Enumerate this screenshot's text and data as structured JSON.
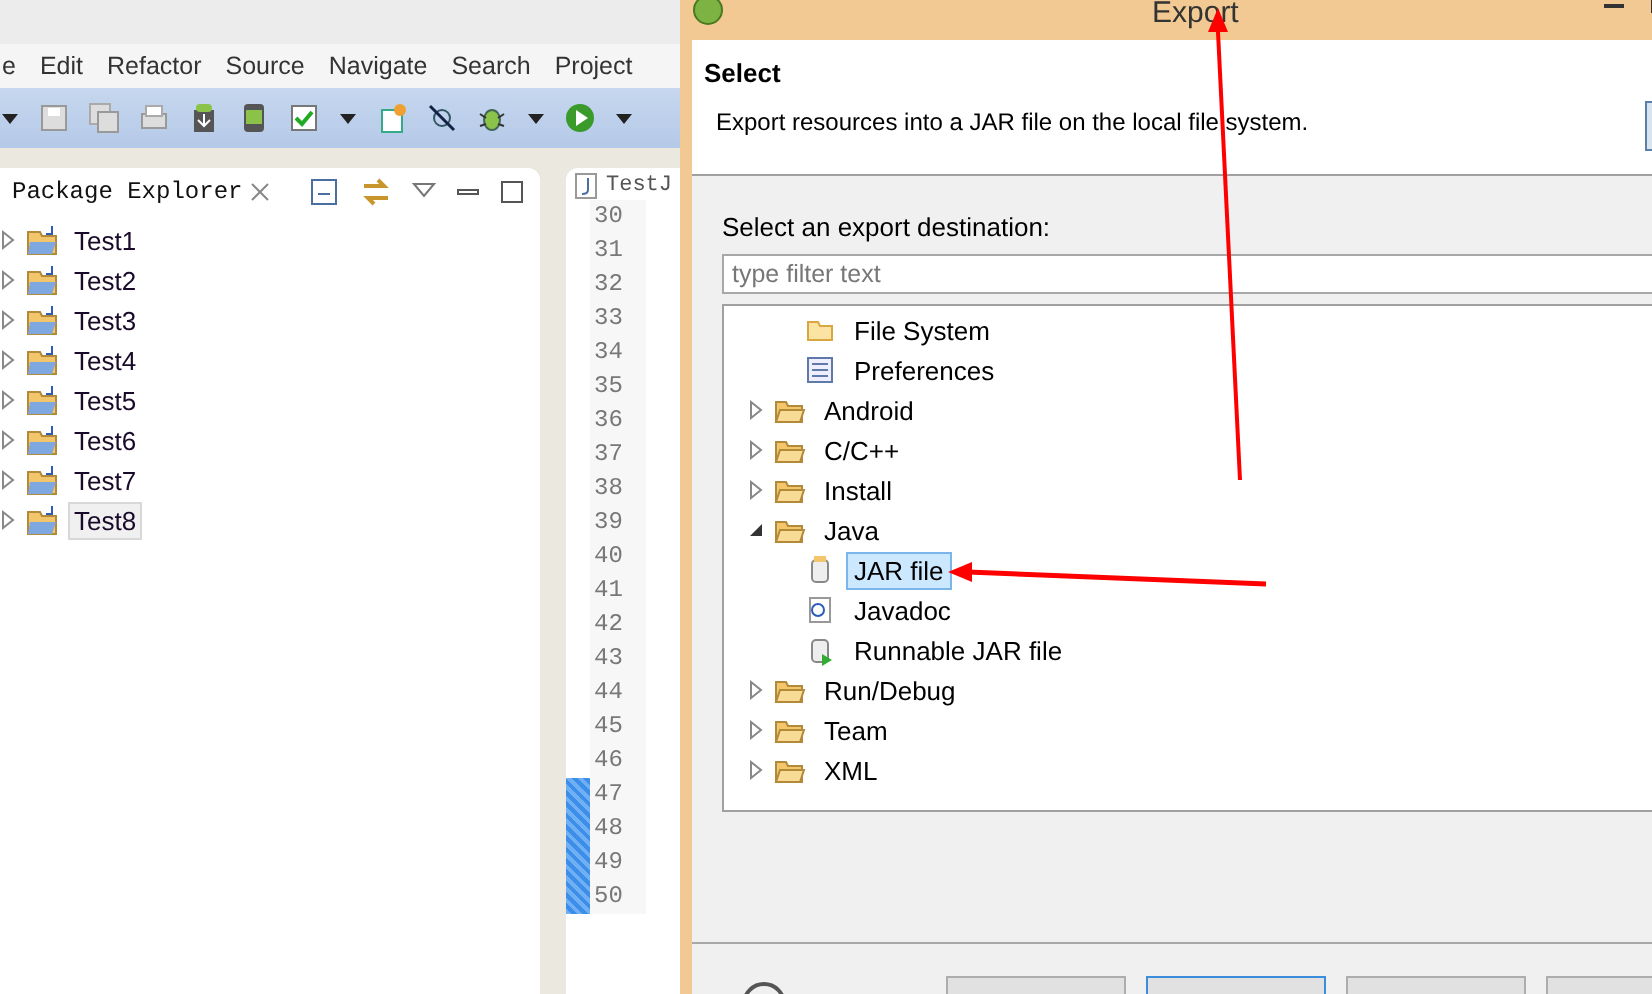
{
  "ide": {
    "menu": [
      "e",
      "Edit",
      "Refactor",
      "Source",
      "Navigate",
      "Search",
      "Project"
    ],
    "explorer": {
      "title": "Package Explorer",
      "projects": [
        {
          "label": "Test1",
          "selected": false
        },
        {
          "label": "Test2",
          "selected": false
        },
        {
          "label": "Test3",
          "selected": false
        },
        {
          "label": "Test4",
          "selected": false
        },
        {
          "label": "Test5",
          "selected": false
        },
        {
          "label": "Test6",
          "selected": false
        },
        {
          "label": "Test7",
          "selected": false
        },
        {
          "label": "Test8",
          "selected": true
        }
      ]
    },
    "editor": {
      "tab": "TestJ",
      "line_numbers": [
        "30",
        "31",
        "32",
        "33",
        "34",
        "35",
        "36",
        "37",
        "38",
        "39",
        "40",
        "41",
        "42",
        "43",
        "44",
        "45",
        "46",
        "47",
        "48",
        "49",
        "50"
      ]
    }
  },
  "dialog": {
    "title": "Export",
    "page_title": "Select",
    "description": "Export resources into a JAR file on the local file system.",
    "destination_label": "Select an export destination:",
    "filter": {
      "placeholder": "type filter text"
    },
    "partial_group_items": [
      {
        "label": "File System",
        "kind": "file-system"
      },
      {
        "label": "Preferences",
        "kind": "preferences"
      }
    ],
    "tree": [
      {
        "label": "Android",
        "kind": "folder",
        "expanded": false
      },
      {
        "label": "C/C++",
        "kind": "folder",
        "expanded": false
      },
      {
        "label": "Install",
        "kind": "folder",
        "expanded": false
      },
      {
        "label": "Java",
        "kind": "folder",
        "expanded": true,
        "children": [
          {
            "label": "JAR file",
            "kind": "jar",
            "selected": true
          },
          {
            "label": "Javadoc",
            "kind": "javadoc",
            "selected": false
          },
          {
            "label": "Runnable JAR file",
            "kind": "runnable-jar",
            "selected": false
          }
        ]
      },
      {
        "label": "Run/Debug",
        "kind": "folder",
        "expanded": false
      },
      {
        "label": "Team",
        "kind": "folder",
        "expanded": false
      },
      {
        "label": "XML",
        "kind": "folder",
        "expanded": false
      }
    ]
  }
}
